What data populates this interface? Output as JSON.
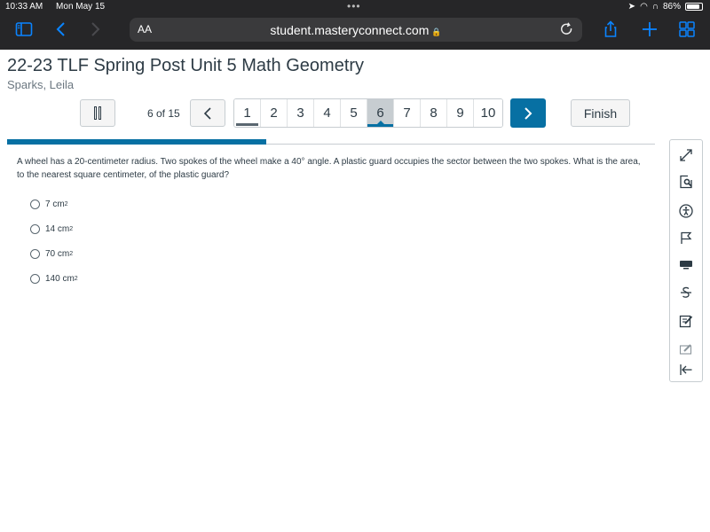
{
  "status_bar": {
    "time": "10:33 AM",
    "date": "Mon May 15",
    "battery": "86%"
  },
  "browser": {
    "text_size_label": "AA",
    "url": "student.masteryconnect.com"
  },
  "assessment": {
    "title": "22-23 TLF Spring Post Unit 5 Math Geometry",
    "student": "Sparks, Leila",
    "counter": "6 of 15",
    "pages": [
      {
        "label": "1",
        "state": "answered"
      },
      {
        "label": "2",
        "state": "default"
      },
      {
        "label": "3",
        "state": "default"
      },
      {
        "label": "4",
        "state": "default"
      },
      {
        "label": "5",
        "state": "default"
      },
      {
        "label": "6",
        "state": "current"
      },
      {
        "label": "7",
        "state": "default"
      },
      {
        "label": "8",
        "state": "default"
      },
      {
        "label": "9",
        "state": "default"
      },
      {
        "label": "10",
        "state": "default"
      }
    ],
    "finish_label": "Finish",
    "progress_fraction": 0.4,
    "accent_color": "#0770a3"
  },
  "question": {
    "text": "A wheel has a 20-centimeter radius. Two spokes of the wheel make a 40° angle. A plastic guard occupies the sector between the two spokes. What is the area, to the nearest square centimeter, of the plastic guard?",
    "choices": [
      {
        "value": "7 cm",
        "unit_exp": "2"
      },
      {
        "value": "14 cm",
        "unit_exp": "2"
      },
      {
        "value": "70 cm",
        "unit_exp": "2"
      },
      {
        "value": "140 cm",
        "unit_exp": "2"
      }
    ]
  },
  "tools": [
    "expand-icon",
    "line-reader-icon",
    "accessibility-icon",
    "flag-icon",
    "keyboard-icon",
    "strikethrough-icon",
    "notepad-icon",
    "highlighter-icon",
    "collapse-icon"
  ]
}
